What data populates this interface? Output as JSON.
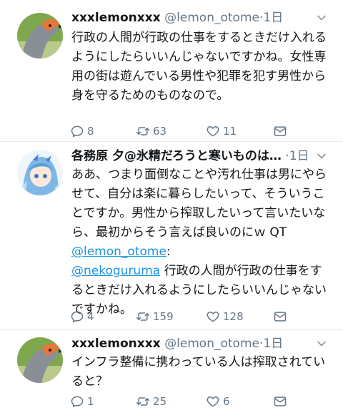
{
  "tweets": [
    {
      "name": "xxxlemonxxx",
      "handle": "@lemon_otome",
      "time": "·1日",
      "text": "行政の人間が行政の仕事をするときだけ入れるようにしたらいいんじゃないですかね。女性専用の街は遊んでいる男性や犯罪を犯す男性から身を守るためのものなので。",
      "replies": "8",
      "retweets": "63",
      "likes": "11"
    },
    {
      "name": "各務原 夕@氷精だろうと寒いものは…",
      "handle": "",
      "time": "·1日",
      "text_pre": "ああ、つまり面倒なことや汚れ仕事は男にやらせて、自分は楽に暮らしたいって、そういうことですか。男性から搾取したいって言いたいなら、最初からそう言えば良いのにｗ QT ",
      "mention1": "@lemon_otome",
      "colon": ":",
      "mention2": "@nekoguruma",
      "text_post": " 行政の人間が行政の仕事をするときだけ入れるようにしたらいいんじゃないですかね。",
      "replies": "4",
      "retweets": "159",
      "likes": "128"
    },
    {
      "name": "xxxlemonxxx",
      "handle": "@lemon_otome",
      "time": "·1日",
      "text": "インフラ整備に携わっている人は搾取されていると？",
      "replies": "1",
      "retweets": "25",
      "likes": "6"
    }
  ],
  "icons": {
    "reply": "reply-icon",
    "retweet": "retweet-icon",
    "like": "heart-icon",
    "dm": "envelope-icon",
    "caret": "chevron-down-icon"
  },
  "colors": {
    "link": "#1b95e0",
    "meta": "#657786",
    "divider": "#e6ecf0"
  }
}
